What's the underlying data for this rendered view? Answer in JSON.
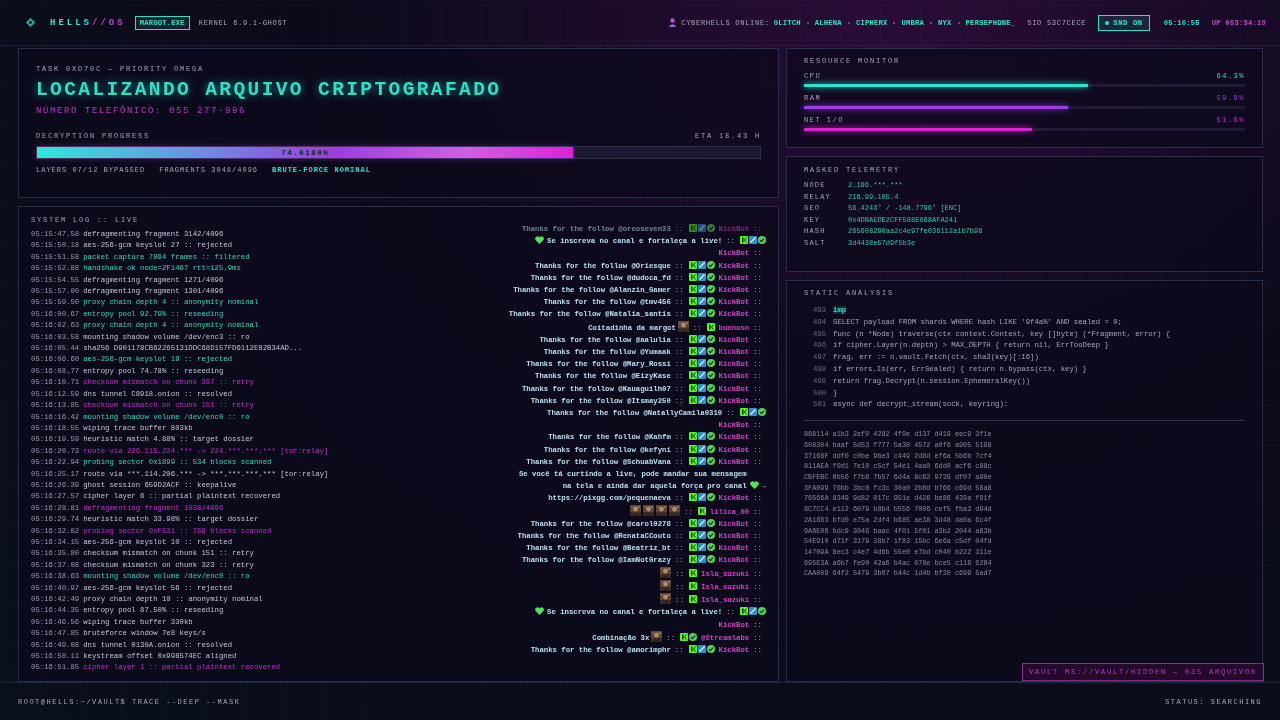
{
  "topbar": {
    "logo_main": "HELLS",
    "logo_suffix": "//OS",
    "process": "MARGOT.EXE",
    "kernel": "KERNEL 6.9.1-GHOST",
    "online_label": "CYBERHELLS ONLINE:",
    "online_users": [
      "GLITCH",
      "ALHENA",
      "CIPHERX",
      "UMBRA",
      "NYX",
      "PERSEPHONE_"
    ],
    "sid": "SID 53C7CECE",
    "sound": {
      "label": "SND ON",
      "on": true
    },
    "clock": "05:16:55",
    "uptime": "UP 053:34:19"
  },
  "task": {
    "label": "TASK 0XD70C — PRIORITY OMEGA",
    "title": "LOCALIZANDO ARQUIVO CRIPTOGRAFADO",
    "phone": "NÚMERO TELEFÔNICO: 055 277-996",
    "progress_label": "DECRYPTION PROGRESS",
    "eta": "ETA 18.43 H",
    "progress": {
      "level": 0.742,
      "reading": "74.6180%"
    },
    "stats": [
      {
        "text": "LAYERS 07/12 BYPASSED",
        "highlight": false
      },
      {
        "text": "FRAGMENTS 3048/4096",
        "highlight": false
      },
      {
        "text": "BRUTE-FORCE NOMINAL",
        "highlight": true
      }
    ]
  },
  "system_log": {
    "title": "SYSTEM LOG :: LIVE",
    "entries": [
      {
        "time": "05:15:47.58",
        "text": "defragmenting fragment 3142/4096",
        "kind": "info"
      },
      {
        "time": "05:15:50.18",
        "text": "aes-256-gcm keyslot 27 :: rejected",
        "kind": "info"
      },
      {
        "time": "05:15:51.58",
        "text": "packet capture 7094 frames :: filtered",
        "kind": "success"
      },
      {
        "time": "05:15:52.88",
        "text": "handshake ok node=2F1407 rtt=125.9ms",
        "kind": "success"
      },
      {
        "time": "05:15:54.55",
        "text": "defragmenting fragment 1271/4096",
        "kind": "info"
      },
      {
        "time": "05:15:57.00",
        "text": "defragmenting fragment 1301/4096",
        "kind": "info"
      },
      {
        "time": "05:15:59.50",
        "text": "proxy chain depth 4 :: anonymity nominal",
        "kind": "success"
      },
      {
        "time": "05:16:00.67",
        "text": "entropy pool 92.79% :: reseeding",
        "kind": "success"
      },
      {
        "time": "05:16:02.63",
        "text": "proxy chain depth 4 :: anonymity nominal",
        "kind": "success"
      },
      {
        "time": "05:16:03.58",
        "text": "mounting shadow volume /dev/enc3 :: ro",
        "kind": "info"
      },
      {
        "time": "05:16:05.44",
        "text": "sha256 D901178CB62265131DDC68D157FD6112E82B34AD...",
        "kind": "info"
      },
      {
        "time": "05:16:06.60",
        "text": "aes-256-gcm keyslot 19 :: rejected",
        "kind": "success"
      },
      {
        "time": "05:16:08.77",
        "text": "entropy pool 74.78% :: reseeding",
        "kind": "info"
      },
      {
        "time": "05:16:10.71",
        "text": "checksum mismatch on chunk 367 :: retry",
        "kind": "alert"
      },
      {
        "time": "05:16:12.59",
        "text": "dns tunnel C8918.onion :: resolved",
        "kind": "info"
      },
      {
        "time": "05:16:13.85",
        "text": "checksum mismatch on chunk 151 :: retry",
        "kind": "alert"
      },
      {
        "time": "05:16:16.42",
        "text": "mounting shadow volume /dev/enc0 :: ro",
        "kind": "success"
      },
      {
        "time": "05:16:18.55",
        "text": "wiping trace buffer 803kb",
        "kind": "info"
      },
      {
        "time": "05:16:19.59",
        "text": "heuristic match 4.88% :: target dossier",
        "kind": "info"
      },
      {
        "time": "05:16:20.73",
        "text": "route via 226.115.224.*** -> 224.***.***.*** [tor:relay]",
        "kind": "alert"
      },
      {
        "time": "05:16:22.94",
        "text": "probing sector 0x1899 :: 534 blocks scanned",
        "kind": "success"
      },
      {
        "time": "05:16:25.17",
        "text": "route via ***.114.206.*** -> ***.***.***.*** [tor:relay]",
        "kind": "info"
      },
      {
        "time": "05:16:26.39",
        "text": "ghost session 659D2ACF :: keepalive",
        "kind": "info"
      },
      {
        "time": "05:16:27.57",
        "text": "cipher layer 6 :: partial plaintext recovered",
        "kind": "info"
      },
      {
        "time": "05:16:28.81",
        "text": "defragmenting fragment 1038/4096",
        "kind": "alert"
      },
      {
        "time": "05:16:29.74",
        "text": "heuristic match 33.98% :: target dossier",
        "kind": "info"
      },
      {
        "time": "05:16:32.02",
        "text": "probing sector 0xF531 :: 758 blocks scanned",
        "kind": "alert"
      },
      {
        "time": "05:16:34.15",
        "text": "aes-256-gcm keyslot 10 :: rejected",
        "kind": "info"
      },
      {
        "time": "05:16:35.80",
        "text": "checksum mismatch on chunk 151 :: retry",
        "kind": "info"
      },
      {
        "time": "05:16:37.08",
        "text": "checksum mismatch on chunk 323 :: retry",
        "kind": "info"
      },
      {
        "time": "05:16:38.63",
        "text": "mounting shadow volume /dev/enc0 :: ro",
        "kind": "success"
      },
      {
        "time": "05:16:40.97",
        "text": "aes-256-gcm keyslot 56 :: rejected",
        "kind": "info"
      },
      {
        "time": "05:16:42.49",
        "text": "proxy chain depth 10 :: anonymity nominal",
        "kind": "info"
      },
      {
        "time": "05:16:44.35",
        "text": "entropy pool 87.50% :: reseeding",
        "kind": "info"
      },
      {
        "time": "05:16:46.56",
        "text": "wiping trace buffer 330kb",
        "kind": "info"
      },
      {
        "time": "05:16:47.85",
        "text": "bruteforce window 7e8 keys/s",
        "kind": "info"
      },
      {
        "time": "05:16:49.08",
        "text": "dns tunnel 0130A.onion :: resolved",
        "kind": "info"
      },
      {
        "time": "05:16:50.11",
        "text": "keystream offset 0x998574EC aligned",
        "kind": "info"
      },
      {
        "time": "05:16:51.85",
        "text": "cipher layer 1 :: partial plaintext recovered",
        "kind": "alert"
      }
    ]
  },
  "chat": {
    "messages": [
      {
        "faded": true,
        "parts": [
          {
            "kind": "text",
            "text": "Thanks for the follow @oreoseven33"
          }
        ],
        "sep": "::",
        "badges": [
          {
            "kind": "kick"
          },
          {
            "kind": "mod"
          },
          {
            "kind": "verified"
          }
        ],
        "user": "KickBot",
        "end": "::"
      },
      {
        "faded": false,
        "parts": [
          {
            "kind": "heart"
          },
          {
            "kind": "text",
            "text": "Se inscreva no canal e fortaleça a live!"
          }
        ],
        "sep": "::",
        "badges": [
          {
            "kind": "kick"
          },
          {
            "kind": "mod"
          },
          {
            "kind": "verified"
          }
        ],
        "user": "KickBot",
        "end": "::"
      },
      {
        "faded": false,
        "parts": [
          {
            "kind": "text",
            "text": "Thanks for the follow @Oriesque"
          }
        ],
        "sep": "::",
        "badges": [
          {
            "kind": "kick"
          },
          {
            "kind": "mod"
          },
          {
            "kind": "verified"
          }
        ],
        "user": "KickBot",
        "end": "::"
      },
      {
        "faded": false,
        "parts": [
          {
            "kind": "text",
            "text": "Thanks for the follow @dudoca_fd"
          }
        ],
        "sep": "::",
        "badges": [
          {
            "kind": "kick"
          },
          {
            "kind": "mod"
          },
          {
            "kind": "verified"
          }
        ],
        "user": "KickBot",
        "end": "::"
      },
      {
        "faded": false,
        "parts": [
          {
            "kind": "text",
            "text": "Thanks for the follow @Alanzin_Gamer"
          }
        ],
        "sep": "::",
        "badges": [
          {
            "kind": "kick"
          },
          {
            "kind": "mod"
          },
          {
            "kind": "verified"
          }
        ],
        "user": "KickBot",
        "end": "::"
      },
      {
        "faded": false,
        "parts": [
          {
            "kind": "text",
            "text": "Thanks for the follow @tmv456"
          }
        ],
        "sep": "::",
        "badges": [
          {
            "kind": "kick"
          },
          {
            "kind": "mod"
          },
          {
            "kind": "verified"
          }
        ],
        "user": "KickBot",
        "end": "::"
      },
      {
        "faded": false,
        "parts": [
          {
            "kind": "text",
            "text": "Thanks for the follow @Natalia_santis"
          }
        ],
        "sep": "::",
        "badges": [
          {
            "kind": "kick"
          },
          {
            "kind": "mod"
          },
          {
            "kind": "verified"
          }
        ],
        "user": "KickBot",
        "end": "::"
      },
      {
        "faded": false,
        "parts": [
          {
            "kind": "text",
            "text": "Coitadinha da margot"
          },
          {
            "kind": "emote"
          }
        ],
        "sep": "::",
        "badges": [
          {
            "kind": "kick"
          }
        ],
        "user": "buenosn",
        "end": "::"
      },
      {
        "faded": false,
        "parts": [
          {
            "kind": "text",
            "text": "Thanks for the follow @aalulia"
          }
        ],
        "sep": "::",
        "badges": [
          {
            "kind": "kick"
          },
          {
            "kind": "mod"
          },
          {
            "kind": "verified"
          }
        ],
        "user": "KickBot",
        "end": "::"
      },
      {
        "faded": false,
        "parts": [
          {
            "kind": "text",
            "text": "Thanks for the follow @Yumaak"
          }
        ],
        "sep": "::",
        "badges": [
          {
            "kind": "kick"
          },
          {
            "kind": "mod"
          },
          {
            "kind": "verified"
          }
        ],
        "user": "KickBot",
        "end": "::"
      },
      {
        "faded": false,
        "parts": [
          {
            "kind": "text",
            "text": "Thanks for the follow @Mary_Rossi"
          }
        ],
        "sep": "::",
        "badges": [
          {
            "kind": "kick"
          },
          {
            "kind": "mod"
          },
          {
            "kind": "verified"
          }
        ],
        "user": "KickBot",
        "end": "::"
      },
      {
        "faded": false,
        "parts": [
          {
            "kind": "text",
            "text": "Thanks for the follow @EizyKase"
          }
        ],
        "sep": "::",
        "badges": [
          {
            "kind": "kick"
          },
          {
            "kind": "mod"
          },
          {
            "kind": "verified"
          }
        ],
        "user": "KickBot",
        "end": "::"
      },
      {
        "faded": false,
        "parts": [
          {
            "kind": "text",
            "text": "Thanks for the follow @Kauaguilh07"
          }
        ],
        "sep": "::",
        "badges": [
          {
            "kind": "kick"
          },
          {
            "kind": "mod"
          },
          {
            "kind": "verified"
          }
        ],
        "user": "KickBot",
        "end": "::"
      },
      {
        "faded": false,
        "parts": [
          {
            "kind": "text",
            "text": "Thanks for the follow @Itsmay250"
          }
        ],
        "sep": "::",
        "badges": [
          {
            "kind": "kick"
          },
          {
            "kind": "mod"
          },
          {
            "kind": "verified"
          }
        ],
        "user": "KickBot",
        "end": "::"
      },
      {
        "faded": false,
        "parts": [
          {
            "kind": "text",
            "text": "Thanks for the follow @NatallyCamila0310"
          }
        ],
        "sep": "::",
        "badges": [
          {
            "kind": "kick"
          },
          {
            "kind": "mod"
          },
          {
            "kind": "verified"
          }
        ],
        "user": "KickBot",
        "end": "::"
      },
      {
        "faded": false,
        "parts": [
          {
            "kind": "text",
            "text": "Thanks for the follow @Kahfm"
          }
        ],
        "sep": "::",
        "badges": [
          {
            "kind": "kick"
          },
          {
            "kind": "mod"
          },
          {
            "kind": "verified"
          }
        ],
        "user": "KickBot",
        "end": "::"
      },
      {
        "faded": false,
        "parts": [
          {
            "kind": "text",
            "text": "Thanks for the follow @kefyni"
          }
        ],
        "sep": "::",
        "badges": [
          {
            "kind": "kick"
          },
          {
            "kind": "mod"
          },
          {
            "kind": "verified"
          }
        ],
        "user": "KickBot",
        "end": "::"
      },
      {
        "faded": false,
        "parts": [
          {
            "kind": "text",
            "text": "Thanks for the follow @SchuabVana"
          }
        ],
        "sep": "::",
        "badges": [
          {
            "kind": "kick"
          },
          {
            "kind": "mod"
          },
          {
            "kind": "verified"
          }
        ],
        "user": "KickBot",
        "end": "::"
      },
      {
        "faded": false,
        "parts": [
          {
            "kind": "paragraph",
            "text": "Se você tá curtindo a live, pode mandar sua mensagem na tela e ainda dar aquela força pro canal"
          },
          {
            "kind": "heart"
          },
          {
            "kind": "text",
            "text": "→"
          },
          {
            "kind": "break"
          },
          {
            "kind": "text",
            "text": "https://pixgg.com/pequenaeva"
          }
        ],
        "sep": "::",
        "badges": [
          {
            "kind": "kick"
          },
          {
            "kind": "mod"
          },
          {
            "kind": "verified"
          }
        ],
        "user": "KickBot",
        "end": "::"
      },
      {
        "faded": false,
        "parts": [
          {
            "kind": "emote"
          },
          {
            "kind": "emote"
          },
          {
            "kind": "emote"
          },
          {
            "kind": "emote"
          }
        ],
        "sep": "::",
        "badges": [
          {
            "kind": "kick"
          }
        ],
        "user": "lilica_00",
        "end": "::"
      },
      {
        "faded": false,
        "parts": [
          {
            "kind": "text",
            "text": "Thanks for the follow @carol0278"
          }
        ],
        "sep": "::",
        "badges": [
          {
            "kind": "kick"
          },
          {
            "kind": "mod"
          },
          {
            "kind": "verified"
          }
        ],
        "user": "KickBot",
        "end": "::"
      },
      {
        "faded": false,
        "parts": [
          {
            "kind": "text",
            "text": "Thanks for the follow @RenataCCouto"
          }
        ],
        "sep": "::",
        "badges": [
          {
            "kind": "kick"
          },
          {
            "kind": "mod"
          },
          {
            "kind": "verified"
          }
        ],
        "user": "KickBot",
        "end": "::"
      },
      {
        "faded": false,
        "parts": [
          {
            "kind": "text",
            "text": "Thanks for the follow @Beatriz_bt"
          }
        ],
        "sep": "::",
        "badges": [
          {
            "kind": "kick"
          },
          {
            "kind": "mod"
          },
          {
            "kind": "verified"
          }
        ],
        "user": "KickBot",
        "end": "::"
      },
      {
        "faded": false,
        "parts": [
          {
            "kind": "text",
            "text": "Thanks for the follow @IamNotGrazy"
          }
        ],
        "sep": "::",
        "badges": [
          {
            "kind": "kick"
          },
          {
            "kind": "mod"
          },
          {
            "kind": "verified"
          }
        ],
        "user": "KickBot",
        "end": "::"
      },
      {
        "faded": false,
        "parts": [
          {
            "kind": "emote"
          }
        ],
        "sep": "::",
        "badges": [
          {
            "kind": "kick"
          }
        ],
        "user": "Isla_suzuki",
        "end": "::"
      },
      {
        "faded": false,
        "parts": [
          {
            "kind": "emote"
          }
        ],
        "sep": "::",
        "badges": [
          {
            "kind": "kick"
          }
        ],
        "user": "Isla_suzuki",
        "end": "::"
      },
      {
        "faded": false,
        "parts": [
          {
            "kind": "emote"
          }
        ],
        "sep": "::",
        "badges": [
          {
            "kind": "kick"
          }
        ],
        "user": "Isla_suzuki",
        "end": "::"
      },
      {
        "faded": false,
        "parts": [
          {
            "kind": "heart"
          },
          {
            "kind": "text",
            "text": "Se inscreva no canal e fortaleça a live!"
          }
        ],
        "sep": "::",
        "badges": [
          {
            "kind": "kick"
          },
          {
            "kind": "mod"
          },
          {
            "kind": "verified"
          }
        ],
        "user": "KickBot",
        "end": "::"
      },
      {
        "faded": false,
        "parts": [
          {
            "kind": "text",
            "text": "Combinação 3x"
          },
          {
            "kind": "emote"
          }
        ],
        "sep": "::",
        "badges": [
          {
            "kind": "kick"
          },
          {
            "kind": "verified"
          }
        ],
        "user": "@Streamlabs",
        "end": "::"
      },
      {
        "faded": false,
        "parts": [
          {
            "kind": "text",
            "text": "Thanks for the follow @amorimphr"
          }
        ],
        "sep": "::",
        "badges": [
          {
            "kind": "kick"
          },
          {
            "kind": "mod"
          },
          {
            "kind": "verified"
          }
        ],
        "user": "KickBot",
        "end": "::"
      }
    ]
  },
  "resources": {
    "title": "RESOURCE MONITOR",
    "meters": [
      {
        "name": "CPU",
        "reading": "64.3%",
        "level": 0.643,
        "color": "#22e6cf"
      },
      {
        "name": "RAM",
        "reading": "59.9%",
        "level": 0.599,
        "color": "#9a3ee0"
      },
      {
        "name": "NET I/O",
        "reading": "51.6%",
        "level": 0.516,
        "color": "#d424d6"
      }
    ]
  },
  "telemetry": {
    "title": "MASKED TELEMETRY",
    "rows": [
      {
        "key": "NODE",
        "value": "2.196.***.***"
      },
      {
        "key": "RELAY",
        "value": "216.99.105.4"
      },
      {
        "key": "GEO",
        "value": "56.4243° / -148.7796° [ENC]"
      },
      {
        "key": "KEY",
        "value": "0x4DBAEDE2CFF588E068AFA241"
      },
      {
        "key": "HASH",
        "value": "265608290aa2c4e97fe036112a1b7b98"
      },
      {
        "key": "SALT",
        "value": "3d4438e57d9f5b3e"
      }
    ]
  },
  "static_analysis": {
    "title": "STATIC ANALYSIS",
    "code": [
      {
        "line": "493",
        "text": "imp",
        "current": true
      },
      {
        "line": "494",
        "text": "SELECT payload FROM shards WHERE hash LIKE '9f4a%' AND sealed = 0;",
        "current": false
      },
      {
        "line": "495",
        "text": "func (n *Node) traverse(ctx context.Context, key []byte) (*Fragment, error) {",
        "current": false
      },
      {
        "line": "496",
        "text": "if cipher.Layer(n.depth) > MAX_DEPTH { return nil, ErrTooDeep }",
        "current": false
      },
      {
        "line": "497",
        "text": "frag, err := n.vault.Fetch(ctx, sha3(key)[:16])",
        "current": false
      },
      {
        "line": "498",
        "text": "if errors.Is(err, ErrSealed) { return n.bypass(ctx, key) }",
        "current": false
      },
      {
        "line": "499",
        "text": "return frag.Decrypt(n.session.EphemeralKey())",
        "current": false
      },
      {
        "line": "500",
        "text": "}",
        "current": false
      },
      {
        "line": "501",
        "text": "async def decrypt_stream(sock, keyring):",
        "current": false
      }
    ],
    "hex_dump": [
      "868114 a1b3 2ef0 4282 4f9e d137 d419 eec9 3f1e",
      "608304 baaf 5d53 f777 5a30 4572 a0f6 a905 5198",
      "37168F ddf0 c0be 9be3 c449 2d8d ef6a 5b6b 7cf4",
      "811AEA f0d1 7e10 c5cf 54e1 4aa0 6dd0 acf6 c88c",
      "CBFEBC 0b56 f7b8 7b57 6d4a 8c82 9739 df07 a90e",
      "3FA099 76bb 3bc8 fc3c 30a0 2b8d b766 c69d 58a8",
      "76566A 8349 9d82 017c 951e d426 be86 439a f81f",
      "8C7CC4 e112 6079 b8b4 b556 7006 cef5 fba3 d94d",
      "2A1863 bfd0 e75a 2df4 b685 ae38 3d48 da0a 6c4f",
      "9A6E06 bdc9 3046 baac 4f01 5f01 a3b2 2044 a83b",
      "54E910 d71f 3179 38b7 1f83 15bc 6e6a c5df 04fd",
      "14709A 8ec3 c4e7 4d6b 55e0 e7bd c040 b222 311e",
      "695E3A a6b7 fe90 42a6 b4ac 078e bce5 c118 6284",
      "CAA009 64f2 5479 3b67 b44c 1d4b bf30 c699 5ad7"
    ],
    "vault_badge": "VAULT MS://VAULT/HIDDEN — 035 ARQUIVOS"
  },
  "status_bar": {
    "prompt": "ROOT@HELLS:~/VAULT$ TRACE --DEEP --MASK",
    "status": "STATUS: SEARCHING"
  }
}
